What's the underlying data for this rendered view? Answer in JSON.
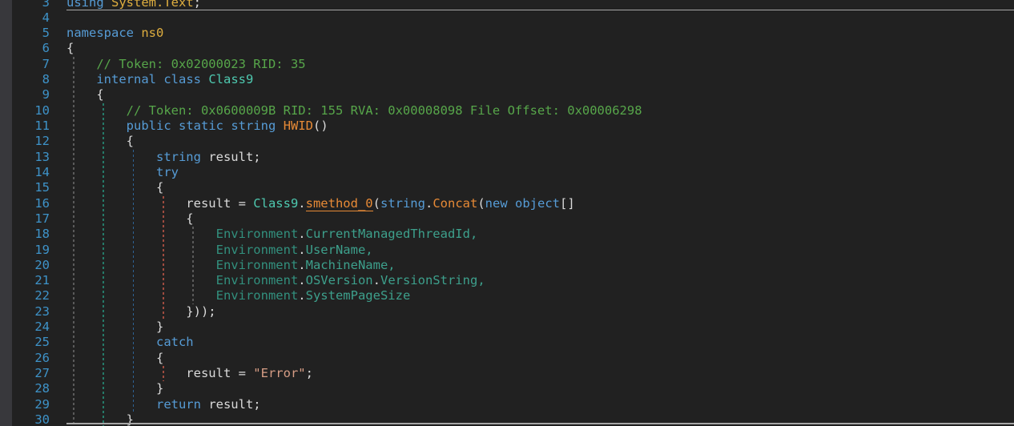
{
  "editor": {
    "background": "#212121",
    "left_strip_color": "#38383C",
    "current_line_border_color": "#A6A6A6",
    "line_number_color": "#3E93C9"
  },
  "colors": {
    "bg": "#212121",
    "strip": "#38383C",
    "curLine": "#A6A6A6",
    "lineNum": "#3E93C9",
    "plain": "#DADADA",
    "keyword": "#569CD6",
    "comment": "#57A64A",
    "namespaceTok": "#DFAE3F",
    "typeTok": "#4EC9B0",
    "methodTok": "#E78A36",
    "envType": "#32907E",
    "envProp": "#3DA08C",
    "stringTok": "#D69D85",
    "guideGray": "#5A5A5A",
    "guideType": "#267A68",
    "guideMethod": "#2E6395",
    "guideTry": "#9E4B3F"
  },
  "code": {
    "first_visible_line": 3,
    "last_visible_line": 30,
    "lines": [
      {
        "n": 3,
        "toks": [
          [
            "kw",
            "using"
          ],
          [
            "pl",
            " "
          ],
          [
            "ns",
            "System.Text"
          ],
          [
            "pl",
            ";"
          ]
        ]
      },
      {
        "n": 4,
        "toks": []
      },
      {
        "n": 5,
        "toks": [
          [
            "kw",
            "namespace"
          ],
          [
            "pl",
            " "
          ],
          [
            "ns",
            "ns0"
          ]
        ]
      },
      {
        "n": 6,
        "toks": [
          [
            "pl",
            "{"
          ]
        ]
      },
      {
        "n": 7,
        "toks": [
          [
            "pl",
            "    "
          ],
          [
            "cm",
            "// Token: 0x02000023 RID: 35"
          ]
        ]
      },
      {
        "n": 8,
        "toks": [
          [
            "pl",
            "    "
          ],
          [
            "kw",
            "internal"
          ],
          [
            "pl",
            " "
          ],
          [
            "kw",
            "class"
          ],
          [
            "pl",
            " "
          ],
          [
            "ty",
            "Class9"
          ]
        ]
      },
      {
        "n": 9,
        "toks": [
          [
            "pl",
            "    {"
          ]
        ]
      },
      {
        "n": 10,
        "toks": [
          [
            "pl",
            "        "
          ],
          [
            "cm",
            "// Token: 0x0600009B RID: 155 RVA: 0x00008098 File Offset: 0x00006298"
          ]
        ]
      },
      {
        "n": 11,
        "toks": [
          [
            "pl",
            "        "
          ],
          [
            "kw",
            "public"
          ],
          [
            "pl",
            " "
          ],
          [
            "kw",
            "static"
          ],
          [
            "pl",
            " "
          ],
          [
            "kw",
            "string"
          ],
          [
            "pl",
            " "
          ],
          [
            "me",
            "HWID"
          ],
          [
            "pl",
            "()"
          ]
        ]
      },
      {
        "n": 12,
        "toks": [
          [
            "pl",
            "        {"
          ]
        ]
      },
      {
        "n": 13,
        "toks": [
          [
            "pl",
            "            "
          ],
          [
            "kw",
            "string"
          ],
          [
            "pl",
            " result;"
          ]
        ]
      },
      {
        "n": 14,
        "toks": [
          [
            "pl",
            "            "
          ],
          [
            "kw",
            "try"
          ]
        ]
      },
      {
        "n": 15,
        "toks": [
          [
            "pl",
            "            {"
          ]
        ]
      },
      {
        "n": 16,
        "toks": [
          [
            "pl",
            "                result = "
          ],
          [
            "ty",
            "Class9"
          ],
          [
            "pl",
            "."
          ],
          [
            "mu",
            "smethod_0"
          ],
          [
            "pl",
            "("
          ],
          [
            "kw",
            "string"
          ],
          [
            "pl",
            "."
          ],
          [
            "me",
            "Concat"
          ],
          [
            "pl",
            "("
          ],
          [
            "kw",
            "new"
          ],
          [
            "pl",
            " "
          ],
          [
            "kw",
            "object"
          ],
          [
            "pl",
            "[]"
          ]
        ]
      },
      {
        "n": 17,
        "toks": [
          [
            "pl",
            "                {"
          ]
        ]
      },
      {
        "n": 18,
        "toks": [
          [
            "pl",
            "                    "
          ],
          [
            "et",
            "Environment"
          ],
          [
            "pl",
            "."
          ],
          [
            "ep",
            "CurrentManagedThreadId"
          ],
          [
            "ep",
            ","
          ]
        ]
      },
      {
        "n": 19,
        "toks": [
          [
            "pl",
            "                    "
          ],
          [
            "et",
            "Environment"
          ],
          [
            "pl",
            "."
          ],
          [
            "ep",
            "UserName"
          ],
          [
            "ep",
            ","
          ]
        ]
      },
      {
        "n": 20,
        "toks": [
          [
            "pl",
            "                    "
          ],
          [
            "et",
            "Environment"
          ],
          [
            "pl",
            "."
          ],
          [
            "ep",
            "MachineName"
          ],
          [
            "ep",
            ","
          ]
        ]
      },
      {
        "n": 21,
        "toks": [
          [
            "pl",
            "                    "
          ],
          [
            "et",
            "Environment"
          ],
          [
            "pl",
            "."
          ],
          [
            "ep",
            "OSVersion"
          ],
          [
            "pl",
            "."
          ],
          [
            "ep",
            "VersionString"
          ],
          [
            "ep",
            ","
          ]
        ]
      },
      {
        "n": 22,
        "toks": [
          [
            "pl",
            "                    "
          ],
          [
            "et",
            "Environment"
          ],
          [
            "pl",
            "."
          ],
          [
            "ep",
            "SystemPageSize"
          ]
        ]
      },
      {
        "n": 23,
        "toks": [
          [
            "pl",
            "                }));"
          ]
        ]
      },
      {
        "n": 24,
        "toks": [
          [
            "pl",
            "            }"
          ]
        ]
      },
      {
        "n": 25,
        "toks": [
          [
            "pl",
            "            "
          ],
          [
            "kw",
            "catch"
          ]
        ]
      },
      {
        "n": 26,
        "toks": [
          [
            "pl",
            "            {"
          ]
        ]
      },
      {
        "n": 27,
        "toks": [
          [
            "pl",
            "                result = "
          ],
          [
            "st",
            "\"Error\""
          ],
          [
            "pl",
            ";"
          ]
        ]
      },
      {
        "n": 28,
        "toks": [
          [
            "pl",
            "            }"
          ]
        ]
      },
      {
        "n": 29,
        "toks": [
          [
            "pl",
            "            "
          ],
          [
            "kw",
            "return"
          ],
          [
            "pl",
            " result;"
          ]
        ]
      },
      {
        "n": 30,
        "toks": [
          [
            "pl",
            "        }"
          ]
        ]
      }
    ],
    "guides": [
      {
        "col": 0,
        "from": 7,
        "to": 31,
        "color": "guideGray"
      },
      {
        "col": 4,
        "from": 10,
        "to": 31,
        "color": "guideType"
      },
      {
        "col": 8,
        "from": 13,
        "to": 29,
        "color": "guideMethod"
      },
      {
        "col": 12,
        "from": 16,
        "to": 23,
        "color": "guideTry"
      },
      {
        "col": 16,
        "from": 18,
        "to": 22,
        "color": "guideGray"
      },
      {
        "col": 12,
        "from": 27,
        "to": 27,
        "color": "guideTry"
      }
    ]
  }
}
